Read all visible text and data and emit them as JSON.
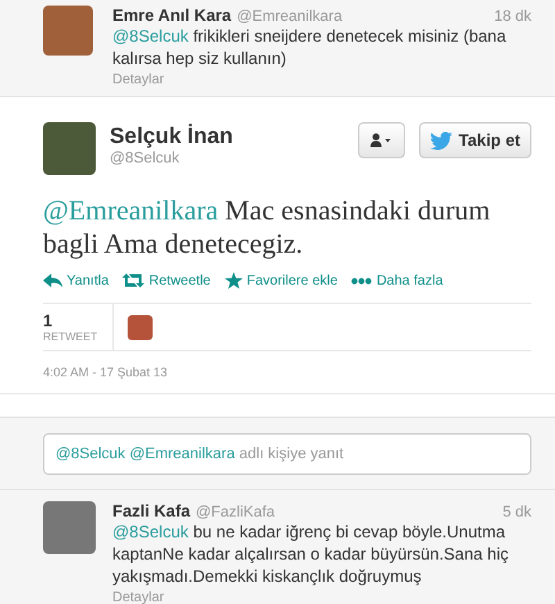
{
  "parent_tweet": {
    "name": "Emre Anıl Kara",
    "handle": "@Emreanilkara",
    "time": "18 dk",
    "mention": "@8Selcuk",
    "text": "frikikleri sneijdere denetecek misiniz (bana kalırsa hep siz kullanın)",
    "details": "Detaylar"
  },
  "main_tweet": {
    "name": "Selçuk İnan",
    "handle": "@8Selcuk",
    "follow_button": "Takip et",
    "mention": "@Emreanilkara",
    "text": "Mac esnasindaki durum bagli Ama denetecegiz.",
    "actions": [
      {
        "kind": "reply",
        "label": "Yanıtla"
      },
      {
        "kind": "retweet",
        "label": "Retweetle"
      },
      {
        "kind": "favorite",
        "label": "Favorilere ekle"
      },
      {
        "kind": "more",
        "label": "Daha fazla"
      }
    ],
    "retweet_count": "1",
    "retweet_label": "RETWEET",
    "timestamp": "4:02 AM - 17 Şubat 13"
  },
  "reply_box": {
    "mentions": "@8Selcuk @Emreanilkara",
    "placeholder": "adlı kişiye yanıt"
  },
  "replies": [
    {
      "name": "Fazli Kafa",
      "handle": "@FazliKafa",
      "time": "5 dk",
      "mention": "@8Selcuk",
      "text": "bu ne kadar iğrenç bi cevap böyle.Unutma kaptanNe kadar alçalırsan o kadar büyürsün.Sana hiç yakışmadı.Demekki kiskançlık doğruymuş",
      "details": "Detaylar"
    }
  ]
}
